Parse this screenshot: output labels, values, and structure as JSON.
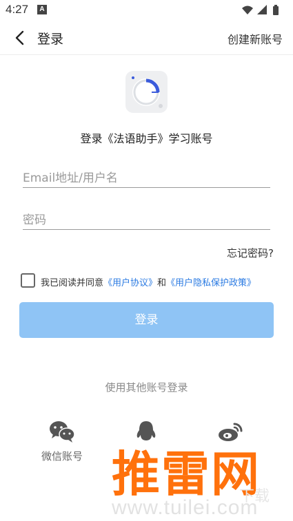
{
  "status_bar": {
    "time": "4:27",
    "notification_letter": "A"
  },
  "nav": {
    "title": "登录",
    "create_account": "创建新账号"
  },
  "app": {
    "title": "登录《法语助手》学习账号"
  },
  "form": {
    "username_placeholder": "Email地址/用户名",
    "password_placeholder": "密码",
    "forgot_password": "忘记密码?"
  },
  "agreement": {
    "prefix": "我已阅读并同意",
    "user_agreement": "《用户协议》",
    "and": "和",
    "privacy_policy": "《用户隐私保护政策》",
    "checked": false
  },
  "login_button": "登录",
  "other_login": {
    "title": "使用其他账号登录",
    "wechat_label": "微信账号"
  },
  "watermark": {
    "brand": "推雷网",
    "cn_sub": "下载",
    "url": "www.tuilei.com"
  },
  "colors": {
    "accent": "#2a7ae2",
    "login_button": "#8fc4f5",
    "watermark": "#ff6a00"
  },
  "icons": [
    "back-arrow-icon",
    "wifi-icon",
    "signal-icon",
    "battery-icon",
    "wechat-icon",
    "qq-icon",
    "weibo-icon"
  ]
}
